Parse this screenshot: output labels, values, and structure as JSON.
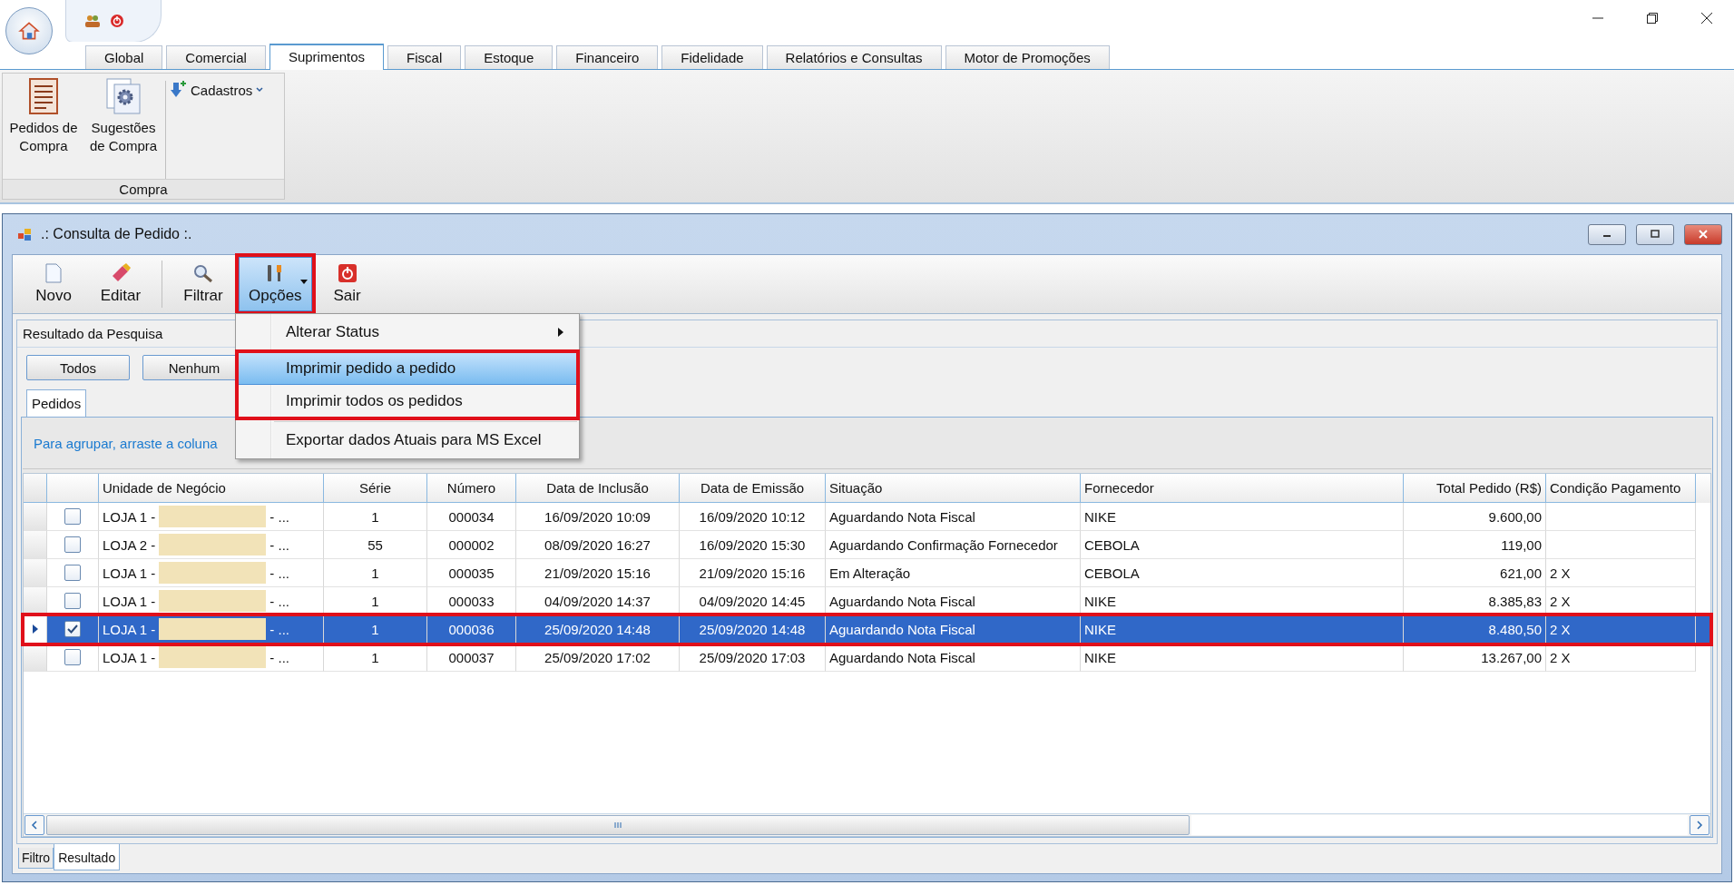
{
  "ribbon_tabs": [
    {
      "label": "Global",
      "selected": false
    },
    {
      "label": "Comercial",
      "selected": false
    },
    {
      "label": "Suprimentos",
      "selected": true
    },
    {
      "label": "Fiscal",
      "selected": false
    },
    {
      "label": "Estoque",
      "selected": false
    },
    {
      "label": "Financeiro",
      "selected": false
    },
    {
      "label": "Fidelidade",
      "selected": false
    },
    {
      "label": "Relatórios e Consultas",
      "selected": false
    },
    {
      "label": "Motor de Promoções",
      "selected": false
    }
  ],
  "ribbon": {
    "group_label": "Compra",
    "buttons": [
      {
        "label": "Pedidos de Compra",
        "kind": "list"
      },
      {
        "label": "Sugestões de Compra",
        "kind": "gear"
      }
    ],
    "dropdown": "Cadastros"
  },
  "window": {
    "title": ".: Consulta de Pedido :."
  },
  "toolbar": [
    {
      "label": "Novo",
      "kind": "new",
      "pressed": false,
      "highlighted": false
    },
    {
      "label": "Editar",
      "kind": "edit",
      "pressed": false,
      "highlighted": false
    },
    {
      "label": "Filtrar",
      "kind": "filter",
      "pressed": false,
      "highlighted": false
    },
    {
      "label": "Opções",
      "kind": "options",
      "pressed": true,
      "highlighted": true
    },
    {
      "label": "Sair",
      "kind": "exit",
      "pressed": false,
      "highlighted": false
    }
  ],
  "menu": {
    "sections": [
      {
        "highlighted": false,
        "items": [
          {
            "label": "Alterar Status",
            "submenu": true,
            "selected": false
          }
        ]
      },
      {
        "highlighted": true,
        "items": [
          {
            "label": "Imprimir pedido a pedido",
            "submenu": false,
            "selected": true
          },
          {
            "label": "Imprimir todos os pedidos",
            "submenu": false,
            "selected": false
          }
        ]
      },
      {
        "highlighted": false,
        "items": [
          {
            "label": "Exportar dados Atuais para MS Excel",
            "submenu": false,
            "selected": false
          }
        ]
      }
    ]
  },
  "results": {
    "title": "Resultado da Pesquisa",
    "buttons": [
      "Todos",
      "Nenhum"
    ],
    "tabs": [
      {
        "label": "Pedidos",
        "selected": true
      }
    ],
    "group_hint": "Para agrupar, arraste a coluna"
  },
  "table": {
    "columns": [
      "Unidade de Negócio",
      "Série",
      "Número",
      "Data de Inclusão",
      "Data de Emissão",
      "Situação",
      "Fornecedor",
      "Total Pedido (R$)",
      "Condição Pagamento"
    ],
    "rows": [
      {
        "unit_start": "LOJA 1 -",
        "unit_end": "- ...",
        "serie": "1",
        "numero": "000034",
        "inclusao": "16/09/2020 10:09",
        "emissao": "16/09/2020 10:12",
        "situacao": "Aguardando Nota Fiscal",
        "fornecedor": "NIKE",
        "total": "9.600,00",
        "condicao": "",
        "checked": false,
        "selected": false,
        "highlighted": false
      },
      {
        "unit_start": "LOJA 2 -",
        "unit_end": "- ...",
        "serie": "55",
        "numero": "000002",
        "inclusao": "08/09/2020 16:27",
        "emissao": "16/09/2020 15:30",
        "situacao": "Aguardando Confirmação Fornecedor",
        "fornecedor": "CEBOLA",
        "total": "119,00",
        "condicao": "",
        "checked": false,
        "selected": false,
        "highlighted": false
      },
      {
        "unit_start": "LOJA 1 -",
        "unit_end": "- ...",
        "serie": "1",
        "numero": "000035",
        "inclusao": "21/09/2020 15:16",
        "emissao": "21/09/2020 15:16",
        "situacao": "Em Alteração",
        "fornecedor": "CEBOLA",
        "total": "621,00",
        "condicao": "2 X",
        "checked": false,
        "selected": false,
        "highlighted": false
      },
      {
        "unit_start": "LOJA 1 -",
        "unit_end": "- ...",
        "serie": "1",
        "numero": "000033",
        "inclusao": "04/09/2020 14:37",
        "emissao": "04/09/2020 14:45",
        "situacao": "Aguardando Nota Fiscal",
        "fornecedor": "NIKE",
        "total": "8.385,83",
        "condicao": "2 X",
        "checked": false,
        "selected": false,
        "highlighted": false
      },
      {
        "unit_start": "LOJA 1 -",
        "unit_end": "- ...",
        "serie": "1",
        "numero": "000036",
        "inclusao": "25/09/2020 14:48",
        "emissao": "25/09/2020 14:48",
        "situacao": "Aguardando Nota Fiscal",
        "fornecedor": "NIKE",
        "total": "8.480,50",
        "condicao": "2 X",
        "checked": true,
        "selected": true,
        "highlighted": true
      },
      {
        "unit_start": "LOJA 1 -",
        "unit_end": "- ...",
        "serie": "1",
        "numero": "000037",
        "inclusao": "25/09/2020 17:02",
        "emissao": "25/09/2020 17:03",
        "situacao": "Aguardando Nota Fiscal",
        "fornecedor": "NIKE",
        "total": "13.267,00",
        "condicao": "2 X",
        "checked": false,
        "selected": false,
        "highlighted": false
      }
    ]
  },
  "bottom_tabs": [
    {
      "label": "Filtro",
      "selected": false
    },
    {
      "label": "Resultado",
      "selected": true
    }
  ]
}
